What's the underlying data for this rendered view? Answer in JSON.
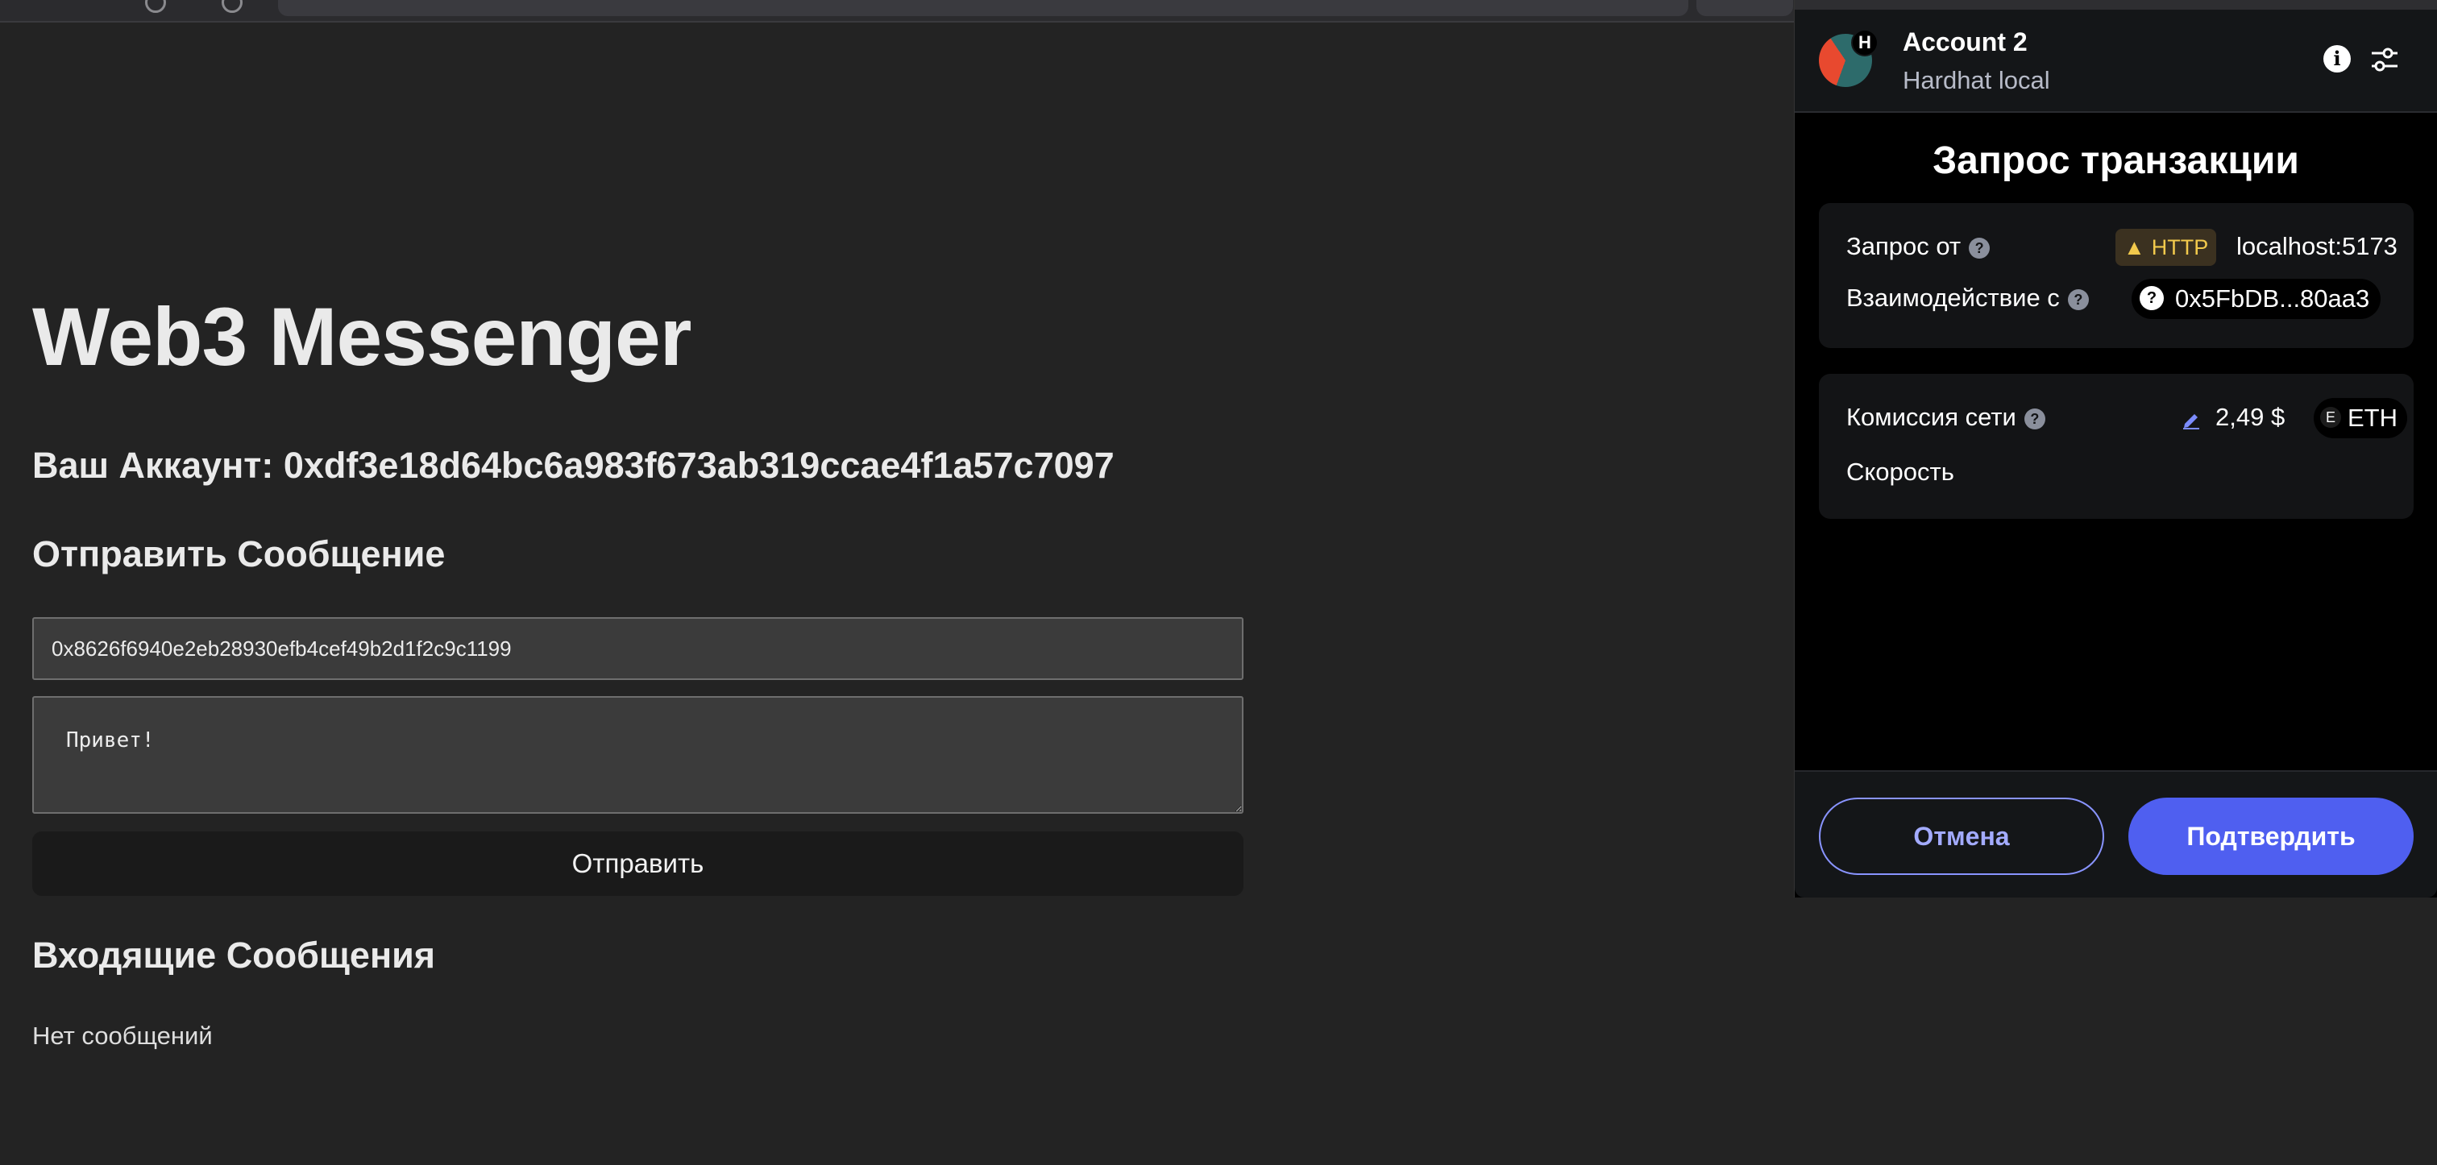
{
  "page": {
    "title": "Web3 Messenger",
    "account_line": "Ваш Аккаунт: 0xdf3e18d64bc6a983f673ab319ccae4f1a57c7097",
    "send_heading": "Отправить Сообщение",
    "recipient_value": "0x8626f6940e2eb28930efb4cef49b2d1f2c9c1199",
    "message_value": "Привет!",
    "send_button": "Отправить",
    "inbox_heading": "Входящие Сообщения",
    "no_messages": "Нет сообщений"
  },
  "wallet": {
    "avatar_badge": "H",
    "account_name": "Account 2",
    "network": "Hardhat local",
    "title": "Запрос транзакции",
    "request_from_label": "Запрос от",
    "http_badge": "HTTP",
    "origin": "localhost:5173",
    "interact_label": "Взаимодействие с",
    "contract": "0x5FbDB...80aa3",
    "fee_label": "Комиссия сети",
    "fee_value": "2,49 $",
    "eth_badge": "E",
    "currency": "ETH",
    "speed_label": "Скорость",
    "cancel_button": "Отмена",
    "confirm_button": "Подтвердить",
    "help_glyph": "?",
    "info_glyph": "i"
  },
  "colors": {
    "background": "#232323",
    "wallet_bg": "#000000",
    "accent": "#4f5ff0",
    "warning": "#f2c94c"
  },
  "icons": [
    "avatar",
    "info-icon",
    "settings-icon",
    "help-icon",
    "warning-icon",
    "question-icon",
    "edit-icon"
  ]
}
